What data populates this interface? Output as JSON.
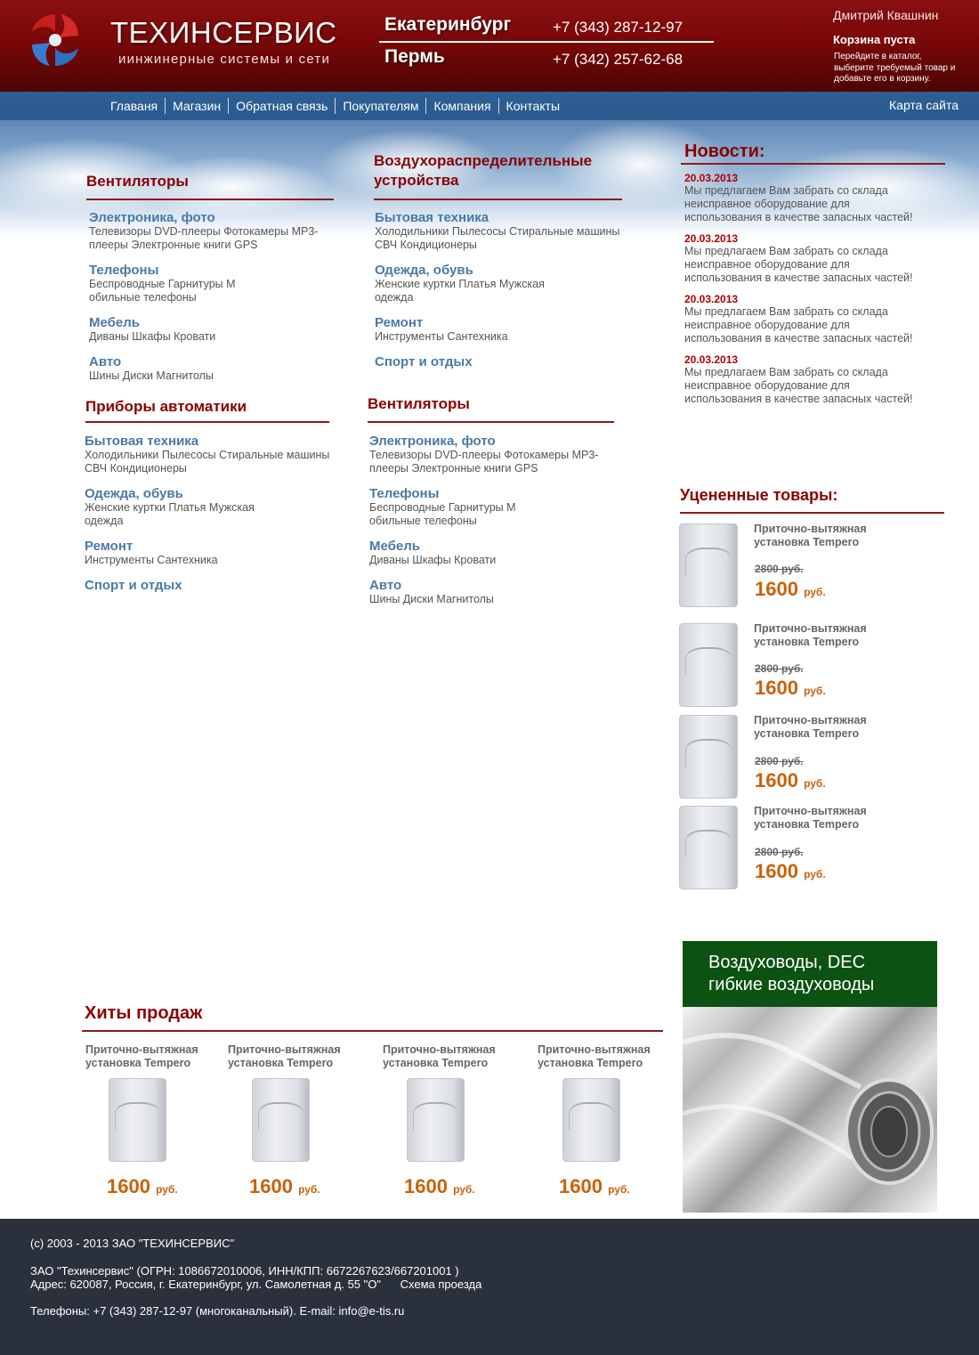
{
  "header": {
    "brand": "ТЕХИНСЕРВИС",
    "tagline": "иинжинерные системы и сети",
    "cities": [
      {
        "name": "Екатеринбург",
        "phone": "+7 (343) 287-12-97"
      },
      {
        "name": "Пермь",
        "phone": "+7 (342) 257-62-68"
      }
    ],
    "user": "Дмитрий Квашнин",
    "cart_status": "Корзина пуста",
    "cart_hint": "Перейдите в каталог, выберите требуемый товар и добавьте его в корзину."
  },
  "nav": {
    "items": [
      "Главаня",
      "Магазин",
      "Обратная связь",
      "Покупателям",
      "Компания",
      "Контакты"
    ],
    "sitemap": "Карта сайта"
  },
  "categories": [
    {
      "title": "Вентиляторы",
      "subs": [
        {
          "name": "Электроника, фото",
          "items": "Телевизоры DVD-плееры Фотокамеры MP3-плееры Электронные книги GPS"
        },
        {
          "name": "Телефоны",
          "items": "Беспроводные Гарнитуры М обильные телефоны"
        },
        {
          "name": "Мебель",
          "items": "Диваны Шкафы Кровати"
        },
        {
          "name": "Авто",
          "items": "Шины Диски Магнитолы"
        }
      ]
    },
    {
      "title": "Воздухораспределительные устройства",
      "subs": [
        {
          "name": "Бытовая техника",
          "items": "Холодильники Пылесосы Стиральные машины СВЧ Кондиционеры"
        },
        {
          "name": "Одежда, обувь",
          "items": "Женские куртки Платья Мужская одежда"
        },
        {
          "name": "Ремонт",
          "items": "Инструменты Сантехника"
        },
        {
          "name": "Спорт и отдых",
          "items": ""
        }
      ]
    },
    {
      "title": "Приборы автоматики",
      "subs": [
        {
          "name": "Бытовая техника",
          "items": "Холодильники Пылесосы Стиральные машины СВЧ Кондиционеры"
        },
        {
          "name": "Одежда, обувь",
          "items": "Женские куртки Платья Мужская одежда"
        },
        {
          "name": "Ремонт",
          "items": "Инструменты Сантехника"
        },
        {
          "name": "Спорт и отдых",
          "items": ""
        }
      ]
    },
    {
      "title": "Вентиляторы",
      "subs": [
        {
          "name": "Электроника, фото",
          "items": "Телевизоры DVD-плееры Фотокамеры MP3-плееры Электронные книги GPS"
        },
        {
          "name": "Телефоны",
          "items": "Беспроводные Гарнитуры М обильные телефоны"
        },
        {
          "name": "Мебель",
          "items": "Диваны Шкафы Кровати"
        },
        {
          "name": "Авто",
          "items": "Шины Диски Магнитолы"
        }
      ]
    }
  ],
  "news": {
    "title": "Новости:",
    "items": [
      {
        "date": "20.03.2013",
        "text": "Мы предлагаем Вам забрать со склада неисправное оборудование для использования в качестве запасных частей!"
      },
      {
        "date": "20.03.2013",
        "text": "Мы предлагаем Вам забрать со склада неисправное оборудование для использования в качестве запасных частей!"
      },
      {
        "date": "20.03.2013",
        "text": "Мы предлагаем Вам забрать со склада неисправное оборудование для использования в качестве запасных частей!"
      },
      {
        "date": "20.03.2013",
        "text": "Мы предлагаем Вам забрать со склада неисправное оборудование для использования в качестве запасных частей!"
      }
    ]
  },
  "discounted": {
    "title": "Уцененные товары:",
    "items": [
      {
        "name": "Приточно-вытяжная установка Tempero",
        "old_price": "2800 руб.",
        "price": "1600",
        "currency": "руб."
      },
      {
        "name": "Приточно-вытяжная установка Tempero",
        "old_price": "2800 руб.",
        "price": "1600",
        "currency": "руб."
      },
      {
        "name": "Приточно-вытяжная установка Tempero",
        "old_price": "2800 руб.",
        "price": "1600",
        "currency": "руб."
      },
      {
        "name": "Приточно-вытяжная установка Tempero",
        "old_price": "2800 руб.",
        "price": "1600",
        "currency": "руб."
      }
    ]
  },
  "promo": {
    "line1": "Воздуховоды, DEC",
    "line2": "гибкие воздуховоды"
  },
  "hits": {
    "title": "Хиты продаж",
    "items": [
      {
        "name": "Приточно-вытяжная установка Tempero",
        "price": "1600",
        "currency": "руб."
      },
      {
        "name": "Приточно-вытяжная установка Tempero",
        "price": "1600",
        "currency": "руб."
      },
      {
        "name": "Приточно-вытяжная установка Tempero",
        "price": "1600",
        "currency": "руб."
      },
      {
        "name": "Приточно-вытяжная установка Tempero",
        "price": "1600",
        "currency": "руб."
      }
    ]
  },
  "footer": {
    "copyright": "(c) 2003 - 2013  ЗАО \"ТЕХИНСЕРВИС\"",
    "legal": "ЗАО \"Техинсервис\" (ОГРН: 1086672010006, ИНН/КПП: 6672267623/667201001 )",
    "address": "Адрес: 620087, Россия, г. Екатеринбург, ул. Самолетная д. 55 \"О\"",
    "map_link": "Схема проезда",
    "contacts": "Телефоны: +7 (343) 287-12-97 (многоканальный). E-mail: info@e-tis.ru"
  },
  "colors": {
    "header_red": "#7a0808",
    "nav_blue": "#2e5f94",
    "accent_title": "#8b0000",
    "link_blue": "#4a7aa6",
    "price_orange": "#c8610a",
    "promo_green": "#0c5212",
    "footer_dark": "#2b313c"
  }
}
